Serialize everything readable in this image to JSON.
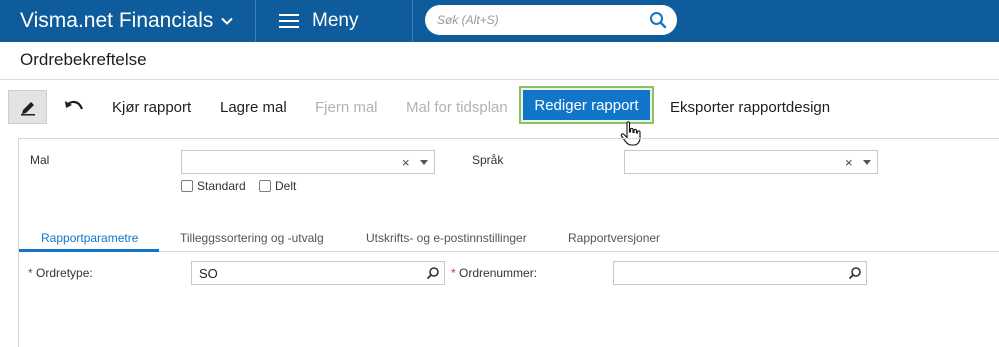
{
  "topbar": {
    "app_name": "Visma.net Financials",
    "menu_label": "Meny",
    "search_placeholder": "Søk (Alt+S)"
  },
  "page": {
    "title": "Ordrebekreftelse"
  },
  "toolbar": {
    "run_report": "Kjør rapport",
    "save_template": "Lagre mal",
    "remove_template": "Fjern mal",
    "template_for_schedule": "Mal for tidsplan",
    "edit_report": "Rediger rapport",
    "export_report_design": "Eksporter rapportdesign"
  },
  "form": {
    "template_label": "Mal",
    "template_value": "",
    "language_label": "Språk",
    "language_value": "",
    "standard_label": "Standard",
    "shared_label": "Delt",
    "clear_symbol": "×"
  },
  "tabs": [
    {
      "label": "Rapportparametre",
      "active": true
    },
    {
      "label": "Tilleggssortering og -utvalg",
      "active": false
    },
    {
      "label": "Utskrifts- og e-postinnstillinger",
      "active": false
    },
    {
      "label": "Rapportversjoner",
      "active": false
    }
  ],
  "params": {
    "order_type_label": "Ordretype:",
    "order_type_value": "SO",
    "order_number_label": "Ordrenummer:",
    "order_number_value": "",
    "required_marker": "*"
  },
  "colors": {
    "topbar": "#0e5c9c",
    "primary": "#1176c9",
    "highlight_border": "#8fbe6a",
    "required": "#d23a3a"
  }
}
